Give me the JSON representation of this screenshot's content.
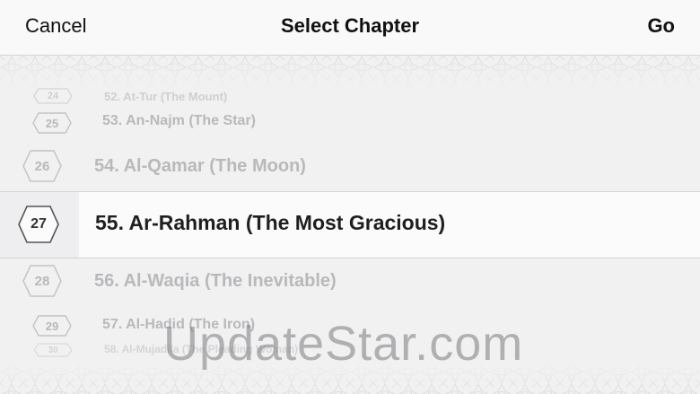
{
  "navbar": {
    "cancel_label": "Cancel",
    "title": "Select Chapter",
    "go_label": "Go"
  },
  "chapters": [
    {
      "badge": "24",
      "label": "52. At-Tur (The Mount)"
    },
    {
      "badge": "25",
      "label": "53. An-Najm (The Star)"
    },
    {
      "badge": "26",
      "label": "54. Al-Qamar (The Moon)"
    },
    {
      "badge": "27",
      "label": "55. Ar-Rahman (The Most Gracious)"
    },
    {
      "badge": "28",
      "label": "56. Al-Waqia (The Inevitable)"
    },
    {
      "badge": "29",
      "label": "57. Al-Hadid (The Iron)"
    },
    {
      "badge": "30",
      "label": "58. Al-Mujadila (The Pleading Woman)"
    }
  ],
  "selected_index": 3,
  "watermark": "UpdateStar.com",
  "colors": {
    "selected_text": "#1f1f1f",
    "faint_text": "#b9b9bc",
    "pattern_stroke": "#c9c9cc"
  }
}
